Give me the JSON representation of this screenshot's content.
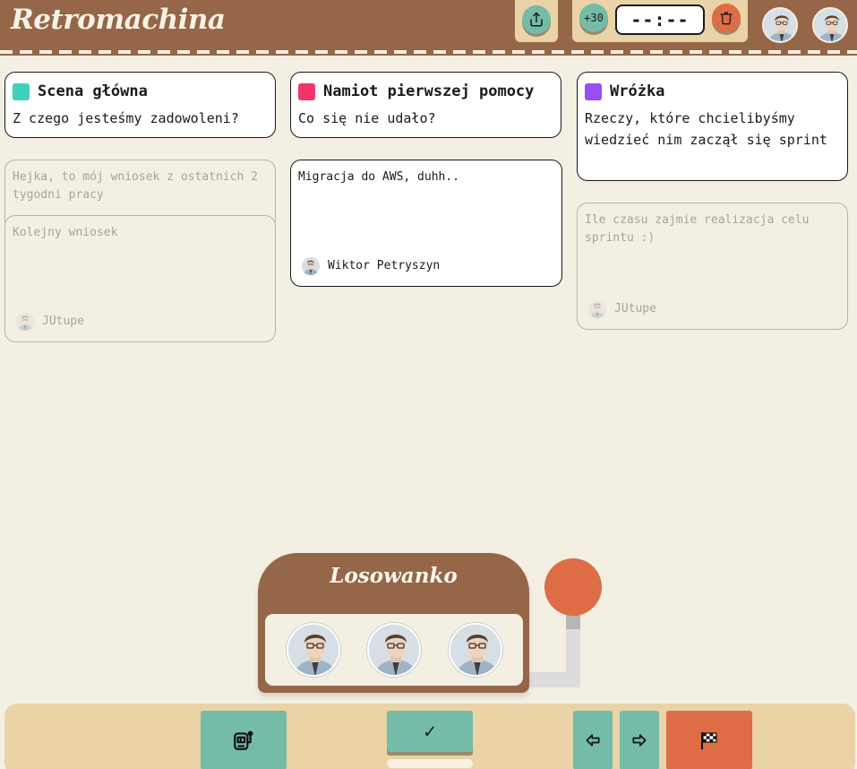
{
  "app": {
    "title": "Retromachina"
  },
  "header": {
    "share_icon": "share-icon",
    "add_time_label": "+30",
    "timer_value": "--:--",
    "trash_icon": "trash-icon"
  },
  "columns": [
    {
      "title": "Scena główna",
      "subtitle": "Z czego jesteśmy zadowoleni?",
      "color": "#3fd1bd"
    },
    {
      "title": "Namiot pierwszej pomocy",
      "subtitle": "Co się nie udało?",
      "color": "#f2356b"
    },
    {
      "title": "Wróżka",
      "subtitle": "Rzeczy, które chcielibyśmy wiedzieć nim zaczął się sprint",
      "color": "#9b4df5"
    }
  ],
  "cards": {
    "col1_card1": {
      "text": "Hejka, to mój wniosek z ostatnich 2 tygodni pracy"
    },
    "col1_card2": {
      "text": "Kolejny wniosek",
      "author": "JUtupe"
    },
    "col2_card1": {
      "text": "Migracja do AWS, duhh..",
      "author": "Wiktor Petryszyn"
    },
    "col3_card1": {
      "text": "Ile czasu zajmie realizacja celu sprintu :)",
      "author": "JUtupe"
    }
  },
  "slot_machine": {
    "title": "Losowanko"
  },
  "footer": {
    "slot_icon": "slot-machine-icon",
    "check_label": "✓",
    "prev_icon": "arrow-left-icon",
    "next_icon": "arrow-right-icon",
    "finish_icon": "checkered-flag-icon"
  }
}
